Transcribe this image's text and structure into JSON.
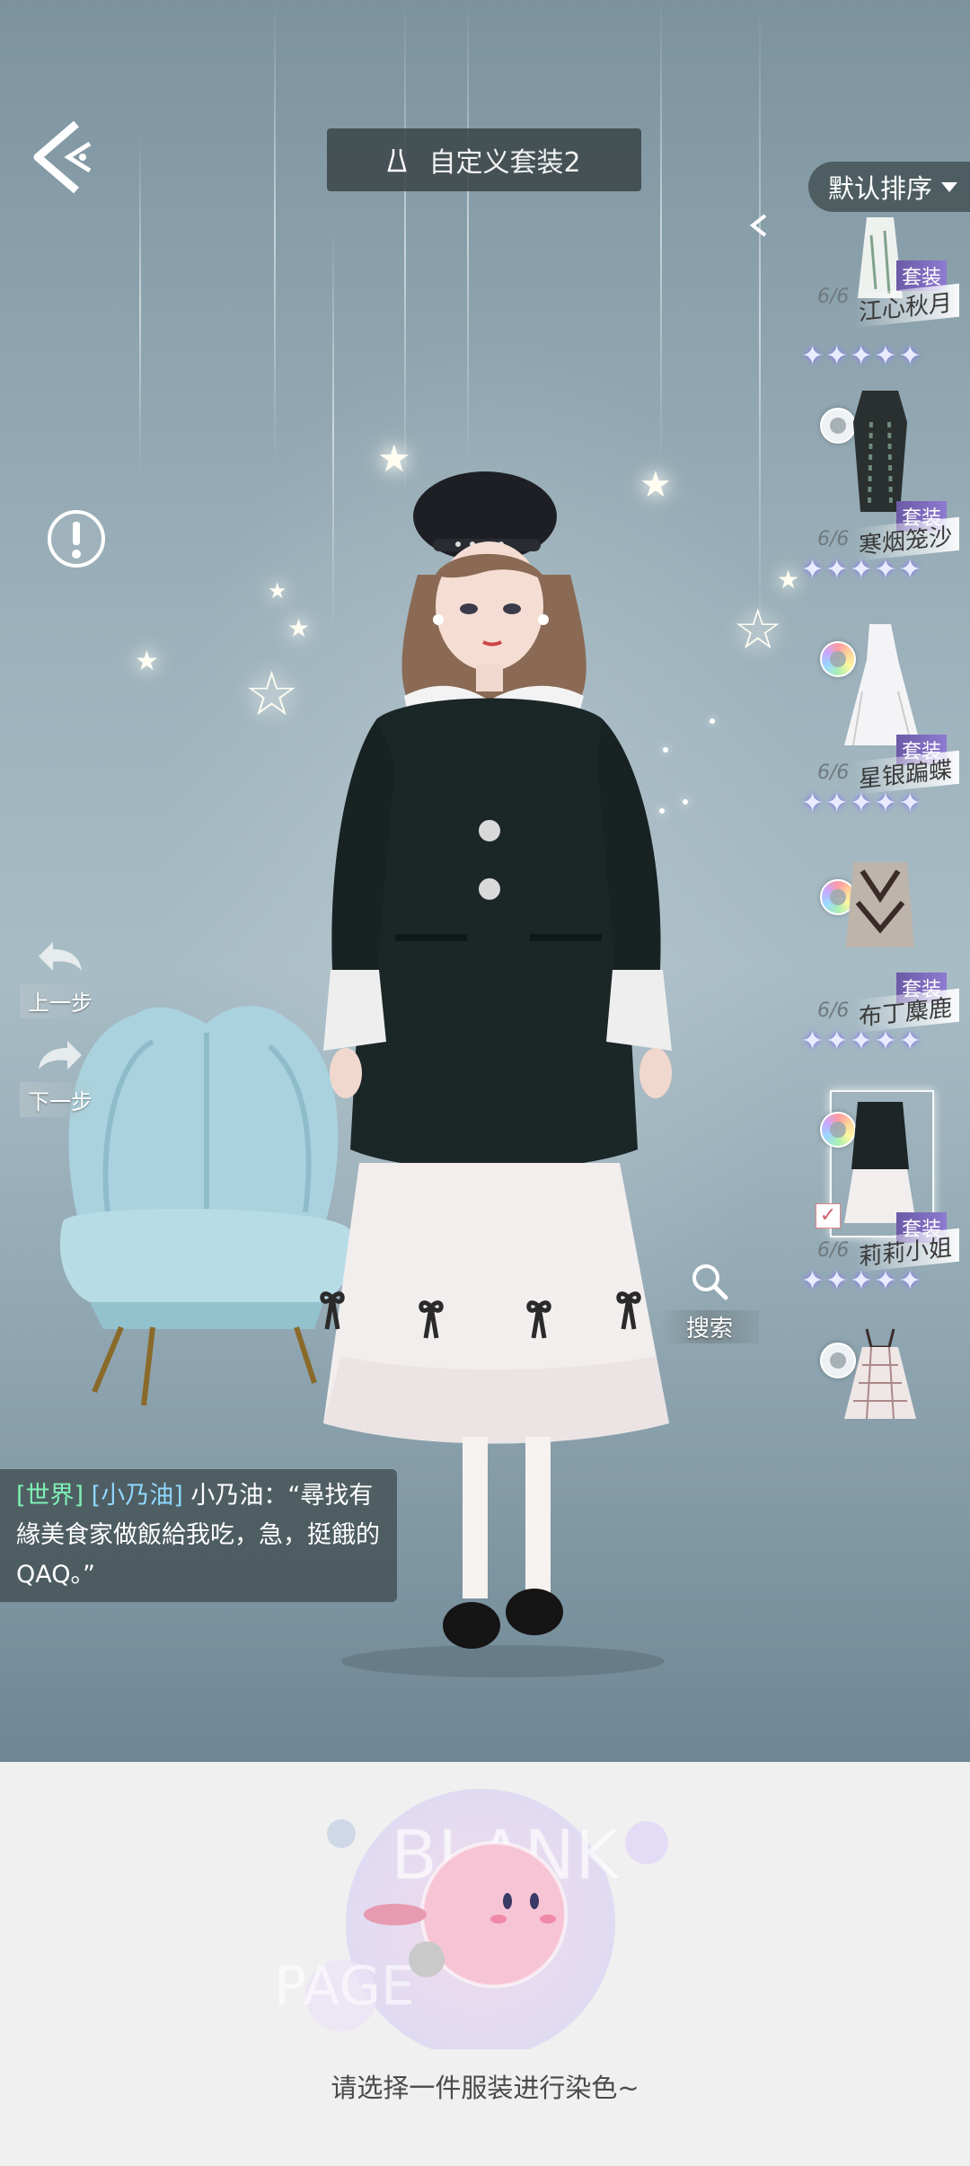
{
  "header": {
    "title": "自定义套装2",
    "sort_label": "默认排序"
  },
  "side_actions": {
    "undo_label": "上一步",
    "redo_label": "下一步",
    "search_label": "搜索"
  },
  "outfits": [
    {
      "name": "江心秋月",
      "count": "6/6",
      "suit_tag": "套装",
      "stars": 5
    },
    {
      "name": "寒烟笼沙",
      "count": "6/6",
      "suit_tag": "套装",
      "stars": 5
    },
    {
      "name": "星银蹁蝶",
      "count": "6/6",
      "suit_tag": "套装",
      "stars": 5
    },
    {
      "name": "布丁麋鹿",
      "count": "6/6",
      "suit_tag": "套装",
      "stars": 5
    },
    {
      "name": "莉莉小姐",
      "count": "6/6",
      "suit_tag": "套装",
      "stars": 5,
      "selected": true
    },
    {
      "name": "",
      "count": "",
      "suit_tag": "",
      "stars": 0
    }
  ],
  "chat": {
    "channel": "[世界]",
    "sender": "[小乃油]",
    "message": "小乃油：“尋找有緣美食家做飯給我吃，急，挺餓的QAQ。”"
  },
  "empty_state": {
    "bg_text_1": "BLANK",
    "bg_text_2": "PAGE",
    "hint": "请选择一件服装进行染色~"
  },
  "colors": {
    "chat_channel": "#7ff0b7",
    "chat_sender": "#8fd7ff",
    "suit_tag": "#7b69c0",
    "bottom_bg": "#f0f0f0"
  }
}
